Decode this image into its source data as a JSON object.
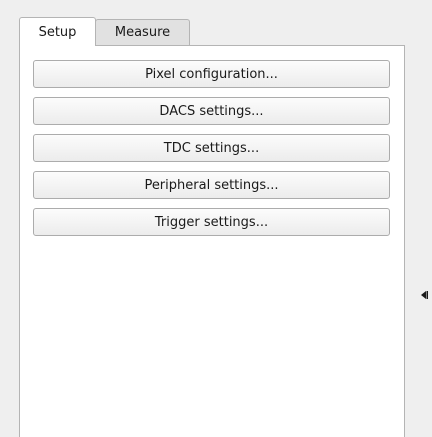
{
  "tabs": [
    {
      "label": "Setup",
      "active": true
    },
    {
      "label": "Measure",
      "active": false
    }
  ],
  "setup_panel": {
    "buttons": [
      {
        "label": "Pixel configuration..."
      },
      {
        "label": "DACS settings..."
      },
      {
        "label": "TDC settings..."
      },
      {
        "label": "Peripheral settings..."
      },
      {
        "label": "Trigger settings..."
      }
    ]
  },
  "splitter": {
    "icon": "collapse-left-icon"
  },
  "colors": {
    "window_bg": "#efefef",
    "pane_bg": "#ffffff",
    "border": "#b4b4b4",
    "text": "#1a1a1a"
  }
}
